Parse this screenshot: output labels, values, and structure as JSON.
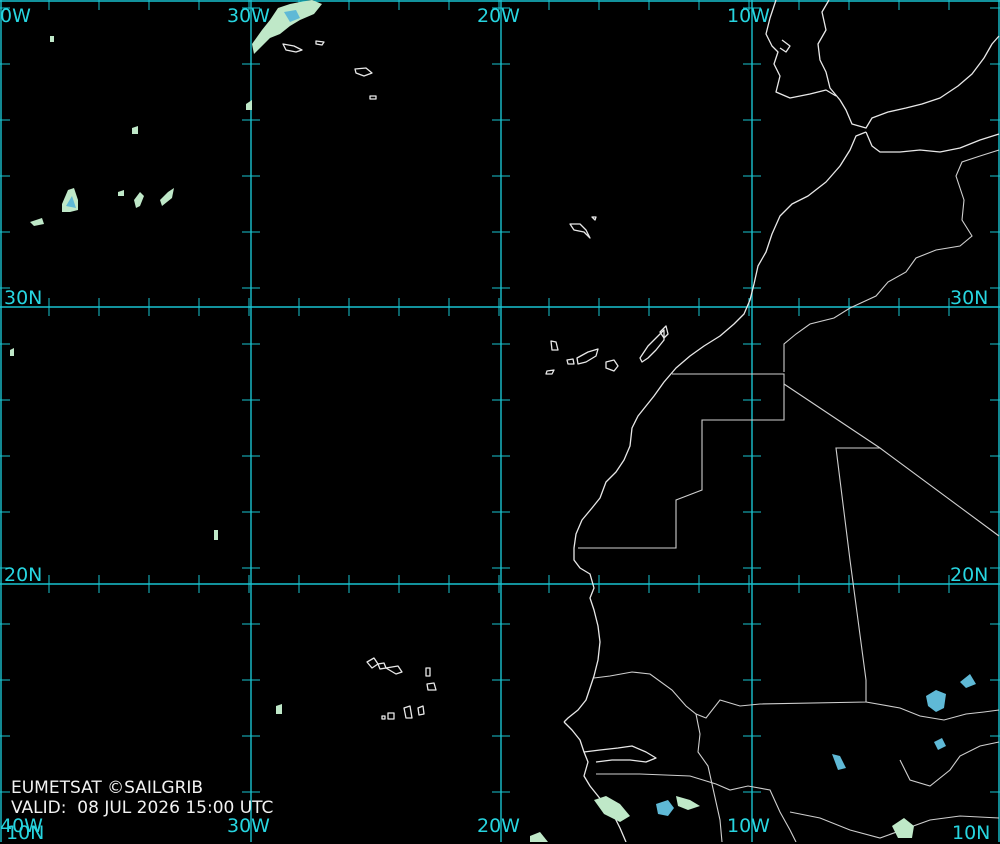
{
  "title": "",
  "longitude_labels": {
    "top": [
      "30W",
      "20W",
      "10W"
    ],
    "bottom": [
      "30W",
      "20W",
      "10W"
    ],
    "left_edge_top": "0W",
    "left_edge_bottom": "40W"
  },
  "latitude_labels": {
    "left": [
      "30N",
      "20N"
    ],
    "right": [
      "30N",
      "20N"
    ],
    "bottom_right": "10N",
    "bottom_left": "10N"
  },
  "credit": {
    "source": "EUMETSAT ©SAILGRIB",
    "valid_label": "VALID:",
    "valid_time": "08 JUL 2026 15:00 UTC"
  },
  "colors": {
    "grid": "#19c3cf",
    "coastline": "#e8e8e8",
    "background": "#000000",
    "cloud_light": "#bfe8c8",
    "cloud_mid": "#5fb9d6"
  }
}
